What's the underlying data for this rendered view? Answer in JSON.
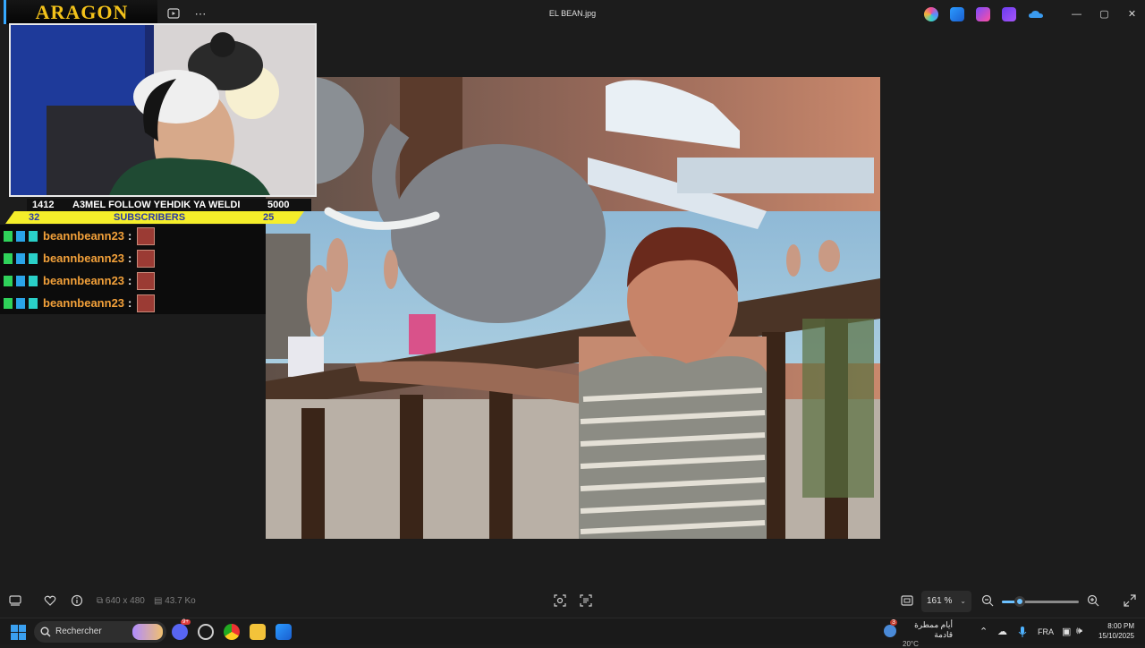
{
  "window": {
    "title": "EL BEAN.jpg",
    "controls": {
      "minimize": "—",
      "maximize": "▢",
      "close": "✕"
    }
  },
  "titlebar_icons": [
    "slideshow-icon",
    "more-icon"
  ],
  "more_label": "⋯",
  "titlebar_apps": [
    "copilot-icon",
    "editor-icon",
    "clipchamp-icon",
    "designer-icon",
    "onedrive-icon"
  ],
  "overlay": {
    "logo_text": "ARAGON",
    "goal": {
      "left_top": "1412",
      "message": "A3MEL FOLLOW YEHDIK YA WELDI",
      "right_top": "5000",
      "left_bottom": "32",
      "label_bottom": "SUBSCRIBERS",
      "right_bottom": "25"
    },
    "chat": [
      {
        "user": "beannbeann23",
        "sep": ":"
      },
      {
        "user": "beannbeann23",
        "sep": ":"
      },
      {
        "user": "beannbeann23",
        "sep": ":"
      },
      {
        "user": "beannbeann23",
        "sep": ":"
      }
    ]
  },
  "toolbar": {
    "dimensions": "640 x 480",
    "filesize": "43.7 Ko",
    "zoom": "161 %",
    "zoom_level_percent": 23
  },
  "taskbar": {
    "search_placeholder": "Rechercher",
    "weather_desc": "أيام ممطرة قادمة",
    "weather_temp": "20°C",
    "weather_badge": "3",
    "chat_badge": "9+",
    "language": "FRA",
    "time": "8:00 PM",
    "date": "15/10/2025"
  },
  "colors": {
    "accent": "#6cc1ff",
    "logo_gold": "#f3c21a",
    "goal_yellow": "#f5ee2a",
    "chat_username": "#f3a13a"
  }
}
